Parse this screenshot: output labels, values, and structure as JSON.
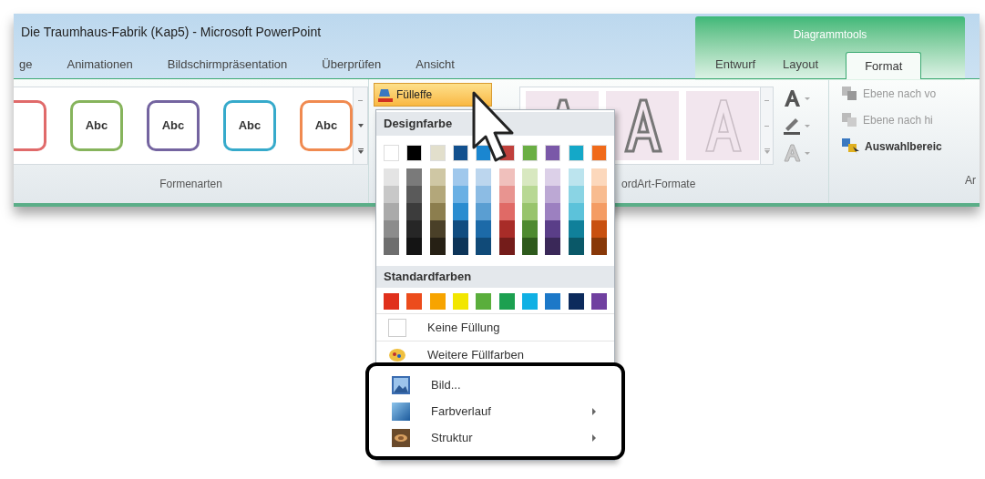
{
  "window": {
    "title": "Die Traumhaus-Fabrik (Kap5) - Microsoft PowerPoint"
  },
  "contextual_group": {
    "title": "Diagrammtools"
  },
  "tabs": [
    {
      "label": "ge",
      "selected": false
    },
    {
      "label": "Animationen",
      "selected": false
    },
    {
      "label": "Bildschirmpräsentation",
      "selected": false
    },
    {
      "label": "Überprüfen",
      "selected": false
    },
    {
      "label": "Ansicht",
      "selected": false
    }
  ],
  "contextual_tabs": [
    {
      "label": "Entwurf",
      "selected": false
    },
    {
      "label": "Layout",
      "selected": false
    },
    {
      "label": "Format",
      "selected": true
    }
  ],
  "shape_styles": {
    "label": "Formenarten",
    "items": [
      {
        "color": "#e06a6a"
      },
      {
        "text": "Abc",
        "color": "#86b45c"
      },
      {
        "text": "Abc",
        "color": "#7464a0"
      },
      {
        "text": "Abc",
        "color": "#36aacb"
      },
      {
        "text": "Abc",
        "color": "#f08a50"
      }
    ]
  },
  "fill_button": {
    "label": "Fülleffe",
    "expanded": true
  },
  "wordart": {
    "label": "ordArt-Formate"
  },
  "arrange": {
    "label": "Ar",
    "items": [
      {
        "label": "Ebene nach vo",
        "disabled": true,
        "kind": "forward"
      },
      {
        "label": "Ebene nach hi",
        "disabled": true,
        "kind": "backward"
      },
      {
        "label": "Auswahlbereic",
        "disabled": false,
        "kind": "selection"
      }
    ]
  },
  "menu": {
    "theme_heading": "Designfarbe",
    "theme_colors": [
      {
        "color": "#ffffff",
        "shades": [
          {
            "color": "#e4e4e4"
          },
          {
            "color": "#c8c8c8"
          },
          {
            "color": "#aaaaaa"
          },
          {
            "color": "#8c8c8c"
          },
          {
            "color": "#6e6e6e"
          }
        ]
      },
      {
        "color": "#000000",
        "shades": [
          {
            "color": "#7a7a7a"
          },
          {
            "color": "#5a5a5a"
          },
          {
            "color": "#3c3c3c"
          },
          {
            "color": "#262626"
          },
          {
            "color": "#141414"
          }
        ]
      },
      {
        "color": "#e2dfcc",
        "shades": [
          {
            "color": "#cfc7a4"
          },
          {
            "color": "#b3a77a"
          },
          {
            "color": "#8c7e4e"
          },
          {
            "color": "#4a4028"
          },
          {
            "color": "#262014"
          }
        ]
      },
      {
        "color": "#12508e",
        "shades": [
          {
            "color": "#a0c8ec"
          },
          {
            "color": "#6ab0e4"
          },
          {
            "color": "#2a8cd0"
          },
          {
            "color": "#104c80"
          },
          {
            "color": "#0c3458"
          }
        ]
      },
      {
        "color": "#1a86d0",
        "shades": [
          {
            "color": "#bcd6ee"
          },
          {
            "color": "#8cbce4"
          },
          {
            "color": "#5a9ed2"
          },
          {
            "color": "#1c6aa8"
          },
          {
            "color": "#104a78"
          }
        ]
      },
      {
        "color": "#c0403c",
        "shades": [
          {
            "color": "#f0c0bc"
          },
          {
            "color": "#e89490"
          },
          {
            "color": "#e06a66"
          },
          {
            "color": "#a82c28"
          },
          {
            "color": "#741c1a"
          }
        ]
      },
      {
        "color": "#6aae44",
        "shades": [
          {
            "color": "#d8e8c0"
          },
          {
            "color": "#b8d894"
          },
          {
            "color": "#98c46c"
          },
          {
            "color": "#4e8a30"
          },
          {
            "color": "#2e5a1c"
          }
        ]
      },
      {
        "color": "#7a58a8",
        "shades": [
          {
            "color": "#dcd0e8"
          },
          {
            "color": "#bca8d4"
          },
          {
            "color": "#9c80c0"
          },
          {
            "color": "#5a3e88"
          },
          {
            "color": "#3a2858"
          }
        ]
      },
      {
        "color": "#14a8c8",
        "shades": [
          {
            "color": "#bce4ee"
          },
          {
            "color": "#8ad4e4"
          },
          {
            "color": "#5cc2da"
          },
          {
            "color": "#10809a"
          },
          {
            "color": "#0a5868"
          }
        ]
      },
      {
        "color": "#f06a1a",
        "shades": [
          {
            "color": "#fcd8bc"
          },
          {
            "color": "#f8bc90"
          },
          {
            "color": "#f49c64"
          },
          {
            "color": "#c85010"
          },
          {
            "color": "#883808"
          }
        ]
      }
    ],
    "standard_heading": "Standardfarben",
    "standard_colors": [
      {
        "color": "#e0301c"
      },
      {
        "color": "#ec4c1c"
      },
      {
        "color": "#f7a400"
      },
      {
        "color": "#f2e600"
      },
      {
        "color": "#5aae3c"
      },
      {
        "color": "#1ca050"
      },
      {
        "color": "#10b0e4"
      },
      {
        "color": "#1c78c8"
      },
      {
        "color": "#0c2a5c"
      },
      {
        "color": "#7040a0"
      }
    ],
    "items": [
      {
        "label": "Keine Füllung",
        "kind": "none"
      },
      {
        "label": "Weitere Füllfarben",
        "kind": "palette"
      }
    ],
    "framed_items": [
      {
        "label": "Bild...",
        "kind": "picture",
        "submenu": false
      },
      {
        "label": "Farbverlauf",
        "kind": "gradient",
        "submenu": true
      },
      {
        "label": "Struktur",
        "kind": "texture",
        "submenu": true
      }
    ]
  }
}
